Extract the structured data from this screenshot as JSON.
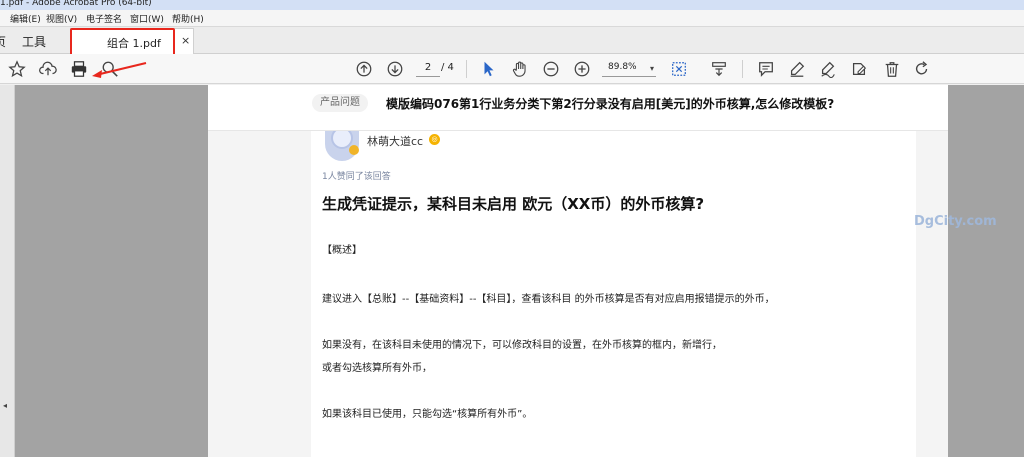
{
  "window": {
    "title": "1.pdf - Adobe Acrobat Pro (64-bit)"
  },
  "menu": [
    "编辑(E)",
    "视图(V)",
    "电子签名",
    "窗口(W)",
    "帮助(H)"
  ],
  "tabs": {
    "home": "页",
    "tools": "工具",
    "document": "组合 1.pdf",
    "close": "×"
  },
  "toolbar": {
    "page_current": "2",
    "page_total": "/ 4",
    "zoom": "89.8%",
    "zoom_caret": "▾"
  },
  "question": {
    "tag": "产品问题",
    "title": "模版编码076第1行业务分类下第2行分录没有启用[美元]的外币核算,怎么修改模板?"
  },
  "answer": {
    "user": "林萌大道cc",
    "badge": "◎",
    "likes": "1人赞同了该回答",
    "title": "生成凭证提示，某科目未启用 欧元（XX币）的外币核算?",
    "paragraphs": [
      "【概述】",
      "建议进入【总账】--【基础资料】--【科目】，查看该科目 的外币核算是否有对应启用报错提示的外币，",
      "如果没有，在该科目未使用的情况下，可以修改科目的设置，在外币核算的框内，新增行，",
      "或者勾选核算所有外币，",
      "如果该科目已使用，只能勾选“核算所有外币”。"
    ]
  },
  "watermark": "DgCity.com",
  "left_strip": {
    "arrow": "◂"
  },
  "colors": {
    "highlight": "#e8271d",
    "accent": "#2a66c8",
    "workspace": "#a3a3a3"
  }
}
